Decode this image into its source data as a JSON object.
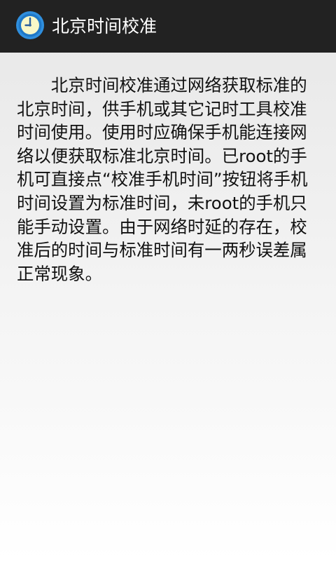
{
  "app_bar": {
    "title": "北京时间校准",
    "icon": "clock-icon",
    "colors": {
      "background": "#222222",
      "icon_ring": "#2f8fde",
      "icon_face": "#f7f7c8",
      "icon_hands": "#2a5f9d"
    }
  },
  "main": {
    "description": "北京时间校准通过网络获取标准的北京时间，供手机或其它记时工具校准时间使用。使用时应确保手机能连接网络以便获取标准北京时间。已root的手机可直接点“校准手机时间”按钮将手机时间设置为标准时间，未root的手机只能手动设置。由于网络时延的存在，校准后的时间与标准时间有一两秒误差属正常现象。"
  }
}
